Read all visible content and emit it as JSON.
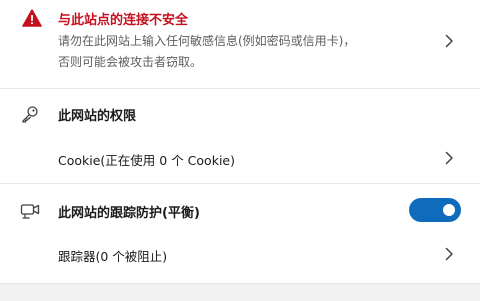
{
  "security_warning": {
    "title": "与此站点的连接不安全",
    "description_line1": "请勿在此网站上输入任何敏感信息(例如密码或信用卡)，",
    "description_line2": "否则可能会被攻击者窃取。",
    "icon": "warning-triangle-icon",
    "color": "#c50f1f"
  },
  "permissions": {
    "title": "此网站的权限",
    "icon": "key-icon",
    "cookie_item": "Cookie(正在使用 0 个 Cookie)"
  },
  "tracking_prevention": {
    "title": "此网站的跟踪防护(平衡)",
    "icon": "camera-tracking-icon",
    "enabled": true,
    "toggle_color": "#0f6cbd",
    "trackers_item": "跟踪器(0 个被阻止)"
  }
}
